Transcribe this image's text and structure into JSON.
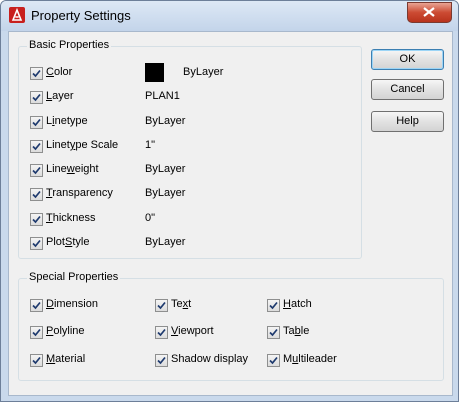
{
  "window": {
    "title": "Property Settings",
    "icon": "autocad-logo-icon"
  },
  "basic": {
    "title": "Basic Properties",
    "items": [
      {
        "label": "Color",
        "mnemonic": "C",
        "value": "ByLayer",
        "checked": true,
        "swatch": "#000000"
      },
      {
        "label": "Layer",
        "mnemonic": "L",
        "value": "PLAN1",
        "checked": true
      },
      {
        "label": "Linetype",
        "mnemonic": "i",
        "value": "ByLayer",
        "checked": true
      },
      {
        "label": "Linetype Scale",
        "mnemonic": "y",
        "value": "1\"",
        "checked": true
      },
      {
        "label": "Lineweight",
        "mnemonic": "w",
        "value": "ByLayer",
        "checked": true
      },
      {
        "label": "Transparency",
        "mnemonic": "T",
        "value": "ByLayer",
        "checked": true
      },
      {
        "label": "Thickness",
        "mnemonic": "T",
        "value": "0\"",
        "checked": true
      },
      {
        "label": "PlotStyle",
        "mnemonic": "S",
        "value": "ByLayer",
        "checked": true
      }
    ]
  },
  "special": {
    "title": "Special Properties",
    "items": [
      {
        "label": "Dimension",
        "mnemonic": "D",
        "checked": true
      },
      {
        "label": "Text",
        "mnemonic": "x",
        "checked": true
      },
      {
        "label": "Hatch",
        "mnemonic": "H",
        "checked": true
      },
      {
        "label": "Polyline",
        "mnemonic": "P",
        "checked": true
      },
      {
        "label": "Viewport",
        "mnemonic": "V",
        "checked": true
      },
      {
        "label": "Table",
        "mnemonic": "b",
        "checked": true
      },
      {
        "label": "Material",
        "mnemonic": "M",
        "checked": true
      },
      {
        "label": "Shadow display",
        "mnemonic": "",
        "checked": true
      },
      {
        "label": "Multileader",
        "mnemonic": "u",
        "checked": true
      }
    ]
  },
  "buttons": {
    "ok": "OK",
    "cancel": "Cancel",
    "help": "Help"
  }
}
